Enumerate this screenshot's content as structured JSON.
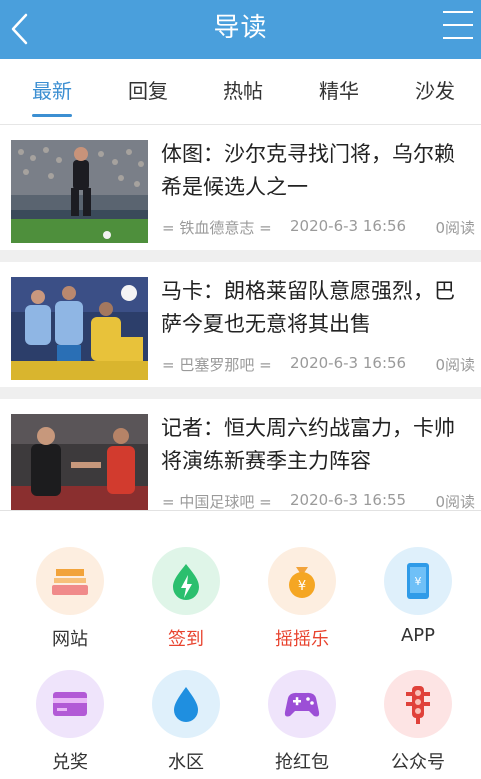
{
  "header": {
    "title": "导读"
  },
  "tabs": [
    {
      "label": "最新",
      "active": true
    },
    {
      "label": "回复",
      "active": false
    },
    {
      "label": "热帖",
      "active": false
    },
    {
      "label": "精华",
      "active": false
    },
    {
      "label": "沙发",
      "active": false
    }
  ],
  "articles": [
    {
      "title": "体图：沙尔克寻找门将，乌尔赖希是候选人之一",
      "source": "= 铁血德意志 =",
      "time": "2020-6-3 16:56",
      "reads": "0阅读"
    },
    {
      "title": "马卡：朗格莱留队意愿强烈，巴萨今夏也无意将其出售",
      "source": "= 巴塞罗那吧 =",
      "time": "2020-6-3 16:56",
      "reads": "0阅读"
    },
    {
      "title": "记者：恒大周六约战富力，卡帅将演练新赛季主力阵容",
      "source": "= 中国足球吧 =",
      "time": "2020-6-3 16:55",
      "reads": "0阅读"
    }
  ],
  "menu_panel": {
    "items": [
      {
        "label": "网站",
        "icon": "website-icon",
        "label_color": "default"
      },
      {
        "label": "签到",
        "icon": "sign-in-icon",
        "label_color": "red"
      },
      {
        "label": "摇摇乐",
        "icon": "shake-icon",
        "label_color": "red"
      },
      {
        "label": "APP",
        "icon": "phone-app-icon",
        "label_color": "default"
      },
      {
        "label": "兑奖",
        "icon": "card-icon",
        "label_color": "default"
      },
      {
        "label": "水区",
        "icon": "water-drop-icon",
        "label_color": "default"
      },
      {
        "label": "抢红包",
        "icon": "gamepad-icon",
        "label_color": "default"
      },
      {
        "label": "公众号",
        "icon": "traffic-light-icon",
        "label_color": "default"
      }
    ]
  },
  "colors": {
    "header": "#4a9fdc",
    "accent": "#3c8fd2",
    "highlight_label": "#e8432e"
  }
}
